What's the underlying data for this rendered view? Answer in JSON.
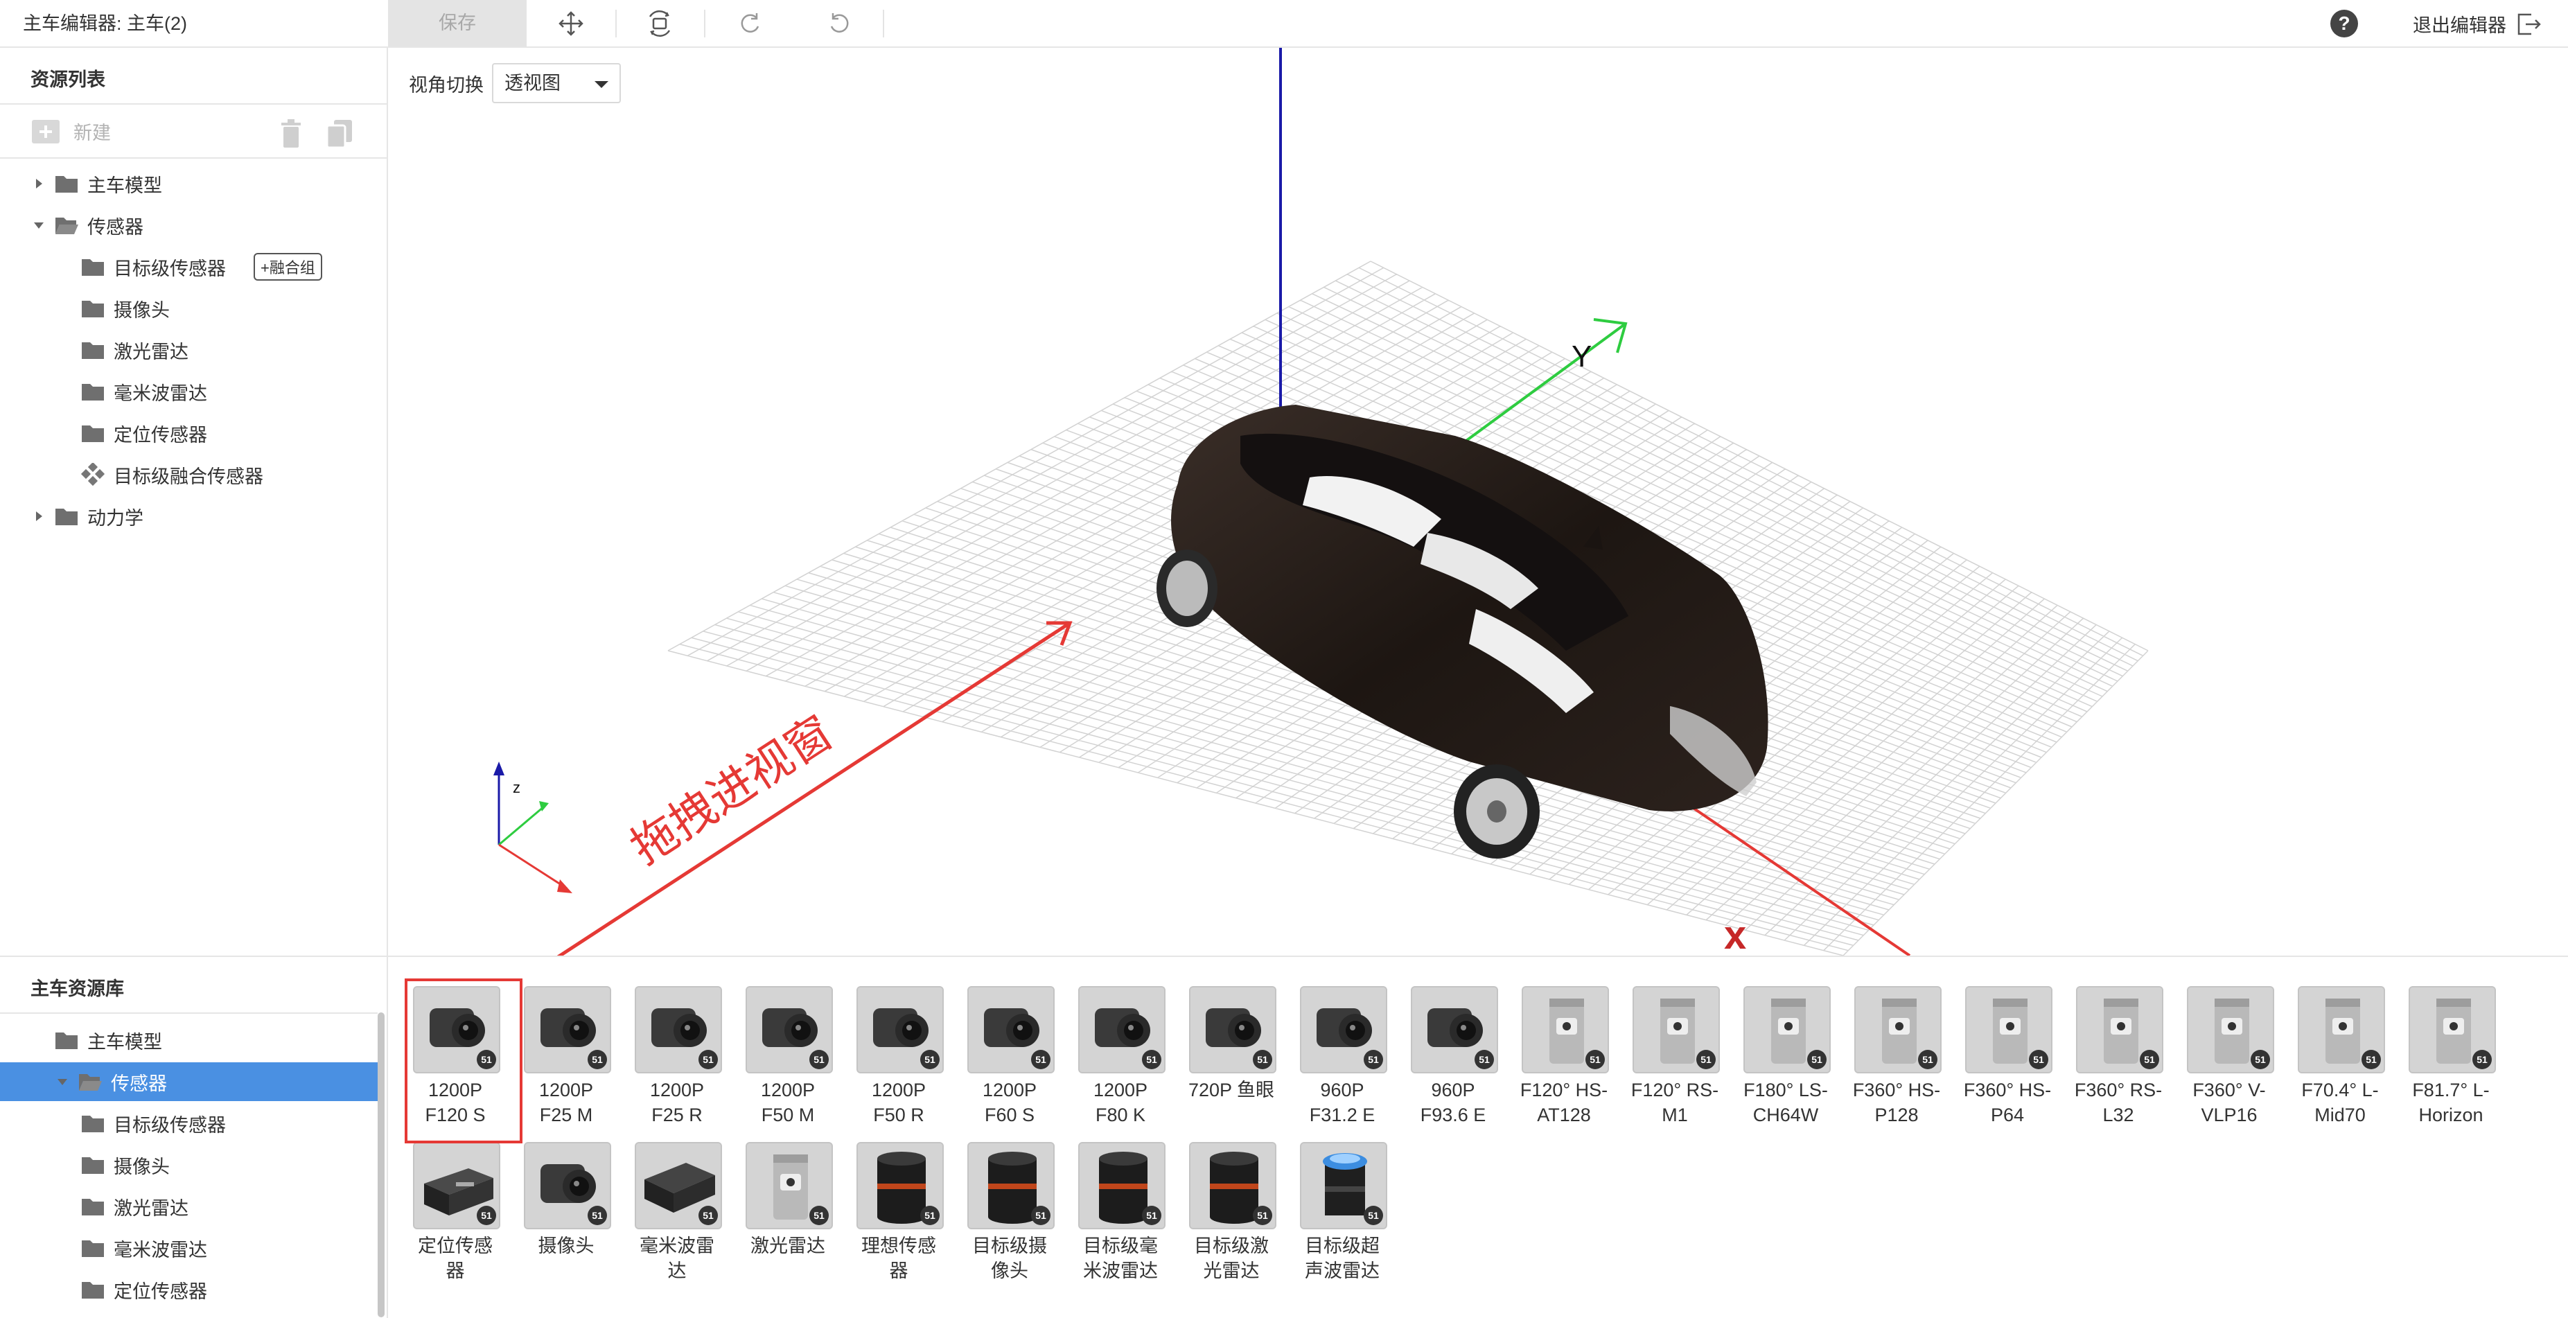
{
  "topbar": {
    "title": "主车编辑器: 主车(2)",
    "save_label": "保存",
    "exit_label": "退出编辑器"
  },
  "resource_list": {
    "title": "资源列表",
    "new_label": "新建",
    "tree": [
      {
        "label": "主车模型",
        "level": 0,
        "expanded": false,
        "type": "folder"
      },
      {
        "label": "传感器",
        "level": 0,
        "expanded": true,
        "type": "folder-open"
      },
      {
        "label": "目标级传感器",
        "level": 1,
        "type": "folder",
        "tag": "+融合组"
      },
      {
        "label": "摄像头",
        "level": 1,
        "type": "folder"
      },
      {
        "label": "激光雷达",
        "level": 1,
        "type": "folder"
      },
      {
        "label": "毫米波雷达",
        "level": 1,
        "type": "folder"
      },
      {
        "label": "定位传感器",
        "level": 1,
        "type": "folder"
      },
      {
        "label": "目标级融合传感器",
        "level": 1,
        "type": "fusion"
      },
      {
        "label": "动力学",
        "level": 0,
        "expanded": false,
        "type": "folder"
      }
    ]
  },
  "viewport": {
    "view_switch_label": "视角切换",
    "view_mode": "透视图",
    "axis_labels": {
      "x": "x",
      "y": "Y",
      "z": "z"
    },
    "annotation": "拖拽进视窗"
  },
  "library": {
    "title": "主车资源库",
    "tree": [
      {
        "label": "主车模型",
        "level": 0,
        "type": "folder"
      },
      {
        "label": "传感器",
        "level": 0,
        "type": "folder-open",
        "selected": true
      },
      {
        "label": "目标级传感器",
        "level": 1,
        "type": "folder"
      },
      {
        "label": "摄像头",
        "level": 1,
        "type": "folder"
      },
      {
        "label": "激光雷达",
        "level": 1,
        "type": "folder"
      },
      {
        "label": "毫米波雷达",
        "level": 1,
        "type": "folder"
      },
      {
        "label": "定位传感器",
        "level": 1,
        "type": "folder"
      }
    ],
    "items": [
      {
        "label": "1200P\nF120 S",
        "icon": "camera-icon"
      },
      {
        "label": "1200P\nF25 M",
        "icon": "camera-icon"
      },
      {
        "label": "1200P\nF25 R",
        "icon": "camera-icon"
      },
      {
        "label": "1200P\nF50 M",
        "icon": "camera-icon"
      },
      {
        "label": "1200P\nF50 R",
        "icon": "camera-icon"
      },
      {
        "label": "1200P\nF60 S",
        "icon": "camera-icon"
      },
      {
        "label": "1200P\nF80 K",
        "icon": "camera-icon"
      },
      {
        "label": "720P 鱼眼",
        "icon": "camera-icon"
      },
      {
        "label": "960P\nF31.2 E",
        "icon": "camera-icon"
      },
      {
        "label": "960P\nF93.6 E",
        "icon": "camera-icon"
      },
      {
        "label": "F120° HS-\nAT128",
        "icon": "lidar-icon"
      },
      {
        "label": "F120° RS-\nM1",
        "icon": "lidar-icon"
      },
      {
        "label": "F180° LS-\nCH64W",
        "icon": "lidar-icon"
      },
      {
        "label": "F360° HS-\nP128",
        "icon": "lidar-icon"
      },
      {
        "label": "F360° HS-\nP64",
        "icon": "lidar-icon"
      },
      {
        "label": "F360° RS-\nL32",
        "icon": "lidar-icon"
      },
      {
        "label": "F360° V-\nVLP16",
        "icon": "lidar-icon"
      },
      {
        "label": "F70.4° L-\nMid70",
        "icon": "lidar-icon"
      },
      {
        "label": "F81.7° L-\nHorizon",
        "icon": "lidar-icon"
      },
      {
        "label": "定位传感\n器",
        "icon": "gps-box-icon"
      },
      {
        "label": "摄像头",
        "icon": "camera-icon"
      },
      {
        "label": "毫米波雷\n达",
        "icon": "radar-box-icon"
      },
      {
        "label": "激光雷达",
        "icon": "lidar-icon"
      },
      {
        "label": "理想传感\n器",
        "icon": "cylinder-icon"
      },
      {
        "label": "目标级摄\n像头",
        "icon": "cylinder-icon"
      },
      {
        "label": "目标级毫\n米波雷达",
        "icon": "cylinder-icon"
      },
      {
        "label": "目标级激\n光雷达",
        "icon": "cylinder-icon"
      },
      {
        "label": "目标级超\n声波雷达",
        "icon": "ultrasonic-icon"
      }
    ],
    "badge_text": "51"
  },
  "colors": {
    "selection_blue": "#4a90e2",
    "annotation_red": "#e53935",
    "axis_x": "#e53935",
    "axis_y": "#2ecc40",
    "axis_z": "#1a1aa8"
  }
}
